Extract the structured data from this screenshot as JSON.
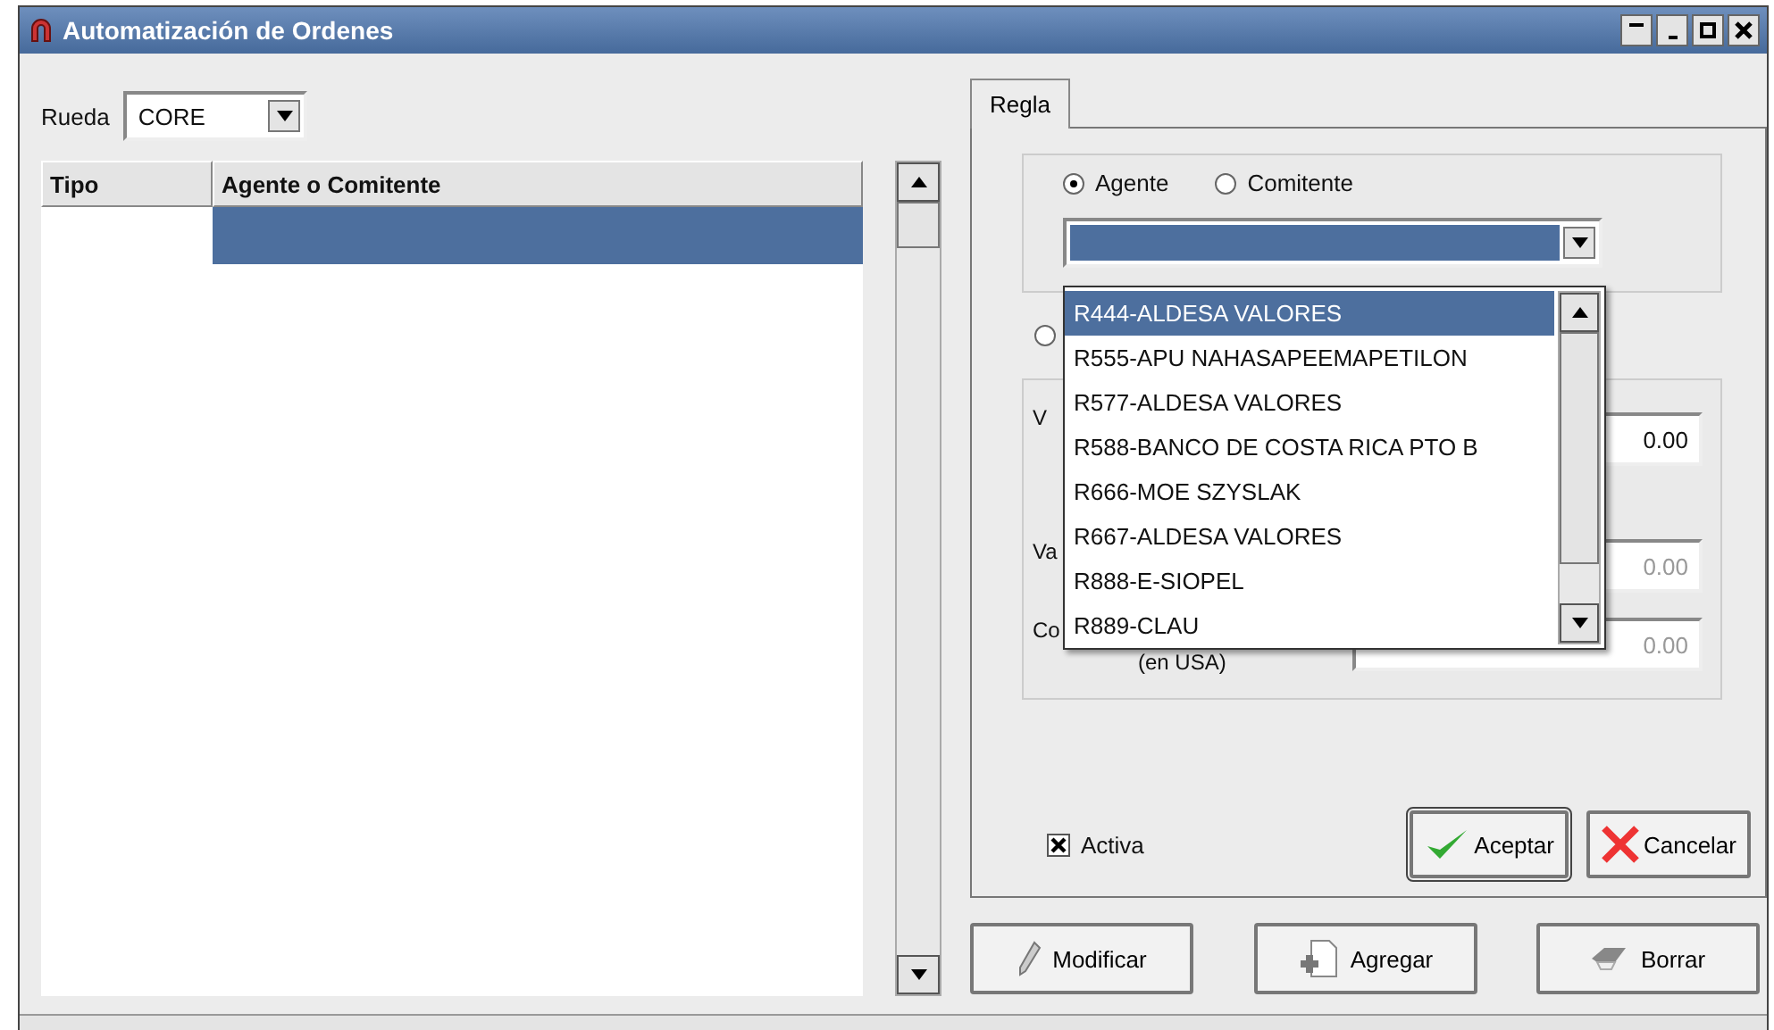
{
  "window": {
    "title": "Automatización de Ordenes"
  },
  "rueda": {
    "label": "Rueda",
    "value": "CORE"
  },
  "table": {
    "columns": [
      "Tipo",
      "Agente o Comitente"
    ],
    "rows": [
      {
        "cells": [
          "",
          ""
        ],
        "selected": true
      }
    ]
  },
  "tabs": [
    {
      "label": "Regla",
      "selected": true
    }
  ],
  "type_radios": [
    {
      "label": "Agente",
      "selected": true
    },
    {
      "label": "Comitente",
      "selected": false
    }
  ],
  "second_radio": {
    "selected": false
  },
  "agent_dropdown": {
    "open": true,
    "options": [
      {
        "label": "R444-ALDESA VALORES",
        "selected": true
      },
      {
        "label": "R555-APU NAHASAPEEMAPETILON",
        "selected": false
      },
      {
        "label": "R577-ALDESA VALORES",
        "selected": false
      },
      {
        "label": "R588-BANCO DE COSTA RICA PTO B",
        "selected": false
      },
      {
        "label": "R666-MOE SZYSLAK",
        "selected": false
      },
      {
        "label": "R667-ALDESA VALORES",
        "selected": false
      },
      {
        "label": "R888-E-SIOPEL",
        "selected": false
      },
      {
        "label": "R889-CLAU",
        "selected": false
      }
    ]
  },
  "fields": [
    {
      "label": "V",
      "value": "0.00",
      "disabled": false
    },
    {
      "label": "Va",
      "value": "0.00",
      "disabled": true
    },
    {
      "label": "Co",
      "sublabel": "(en USA)",
      "value": "0.00",
      "disabled": true
    }
  ],
  "activa": {
    "label": "Activa",
    "checked": true
  },
  "dialog_buttons": [
    {
      "label": "Aceptar",
      "kind": "accept"
    },
    {
      "label": "Cancelar",
      "kind": "cancel"
    }
  ],
  "bottom_buttons": [
    {
      "label": "Modificar",
      "kind": "edit"
    },
    {
      "label": "Agregar",
      "kind": "add"
    },
    {
      "label": "Borrar",
      "kind": "delete"
    }
  ]
}
